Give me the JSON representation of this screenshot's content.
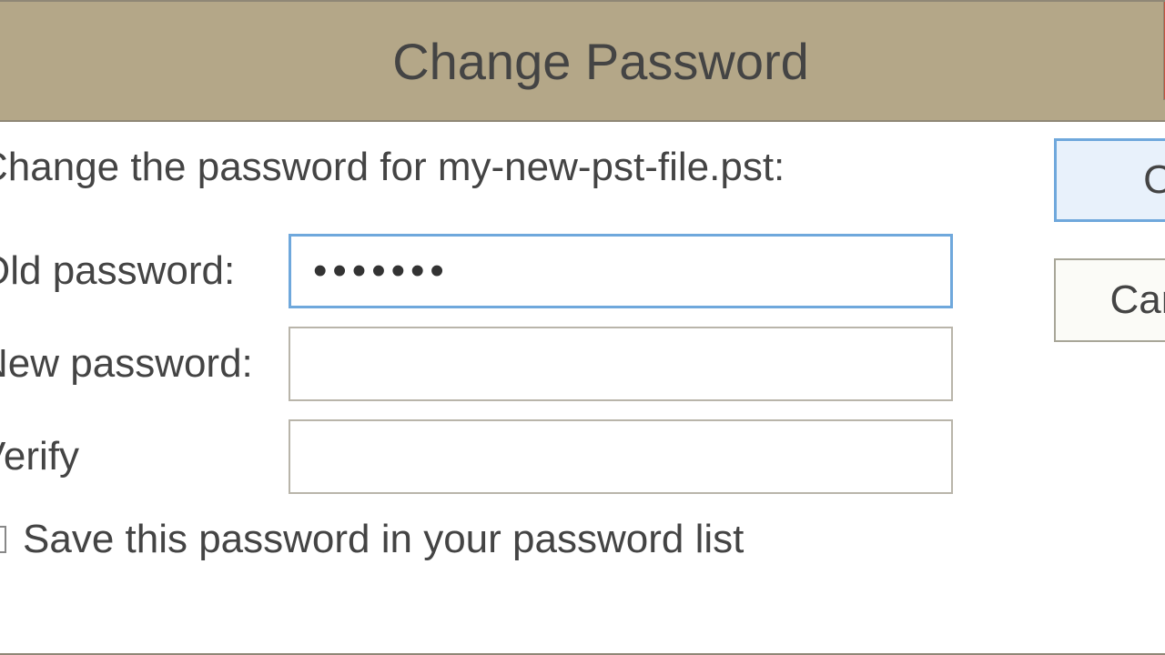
{
  "dialog": {
    "title": "Change Password",
    "instruction": "Change the password for my-new-pst-file.pst:",
    "fields": {
      "old_label": "Old password:",
      "old_value": "•••••••",
      "new_label": "New password:",
      "new_value": "",
      "verify_label": "Verify",
      "verify_value": ""
    },
    "checkbox_label": "Save this password in your password list",
    "buttons": {
      "ok": "OK",
      "cancel": "Cancel"
    }
  }
}
